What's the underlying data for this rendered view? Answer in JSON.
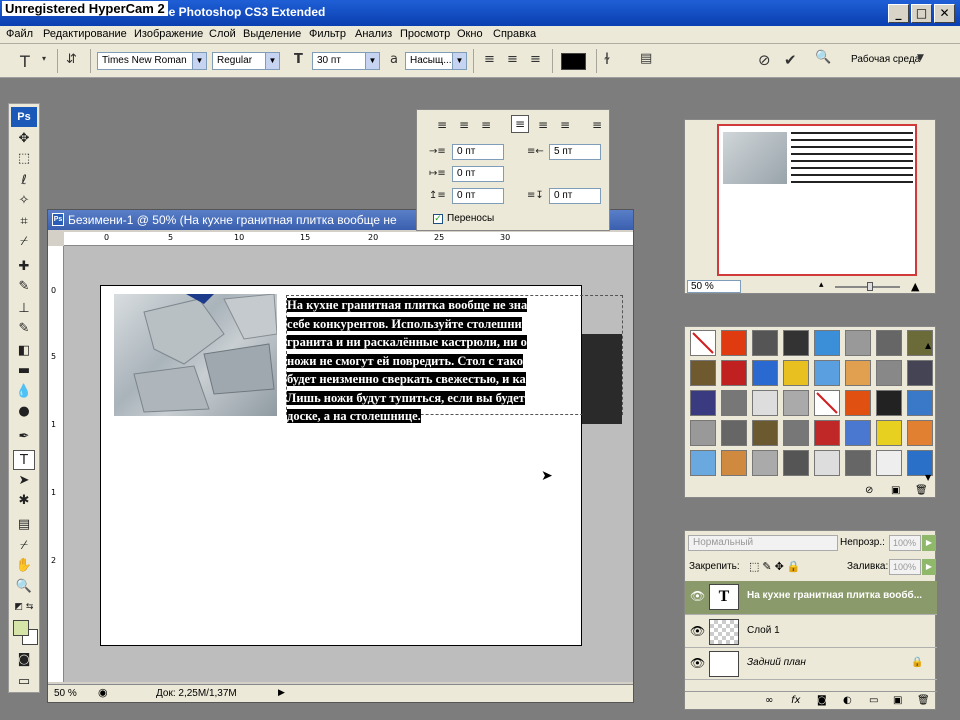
{
  "window": {
    "watermark": "Unregistered HyperCam 2",
    "title": "Adobe Photoshop CS3 Extended",
    "minimize": "_",
    "maximize": "□",
    "close": "✕"
  },
  "menu": [
    "Файл",
    "Редактирование",
    "Изображение",
    "Слой",
    "Выделение",
    "Фильтр",
    "Анализ",
    "Просмотр",
    "Окно",
    "Справка"
  ],
  "options": {
    "font_family": "Times New Roman",
    "font_style": "Regular",
    "font_size": "30 пт",
    "antialias_label": "a",
    "antialias": "Насыщ...",
    "color": "#000000",
    "workspace": "Рабочая среда"
  },
  "paragraph": {
    "left_indent": "0 пт",
    "right_indent": "5 пт",
    "first_line": "0 пт",
    "space_before": "0 пт",
    "space_after": "0 пт",
    "hyphenation": "Переносы"
  },
  "document": {
    "title": "Безимени-1 @ 50% (На кухне гранитная плитка вообще не",
    "text_lines": [
      "На кухне гранитная плитка вообще не зна",
      "себе конкурентов. Используйте столешни",
      "гранита и ни раскалённые кастрюли, ни о",
      "ножи не смогут ей повредить. Стол с тако",
      "будет неизменно сверкать свежестью, и ка",
      "Лишь ножи будут тупиться, если вы будет",
      "доске, а на столешнице."
    ],
    "ruler_top": [
      "0",
      "5",
      "10",
      "15",
      "20",
      "25",
      "30"
    ],
    "ruler_left": [
      "0",
      "5",
      "1",
      "1",
      "2"
    ],
    "zoom": "50 %",
    "doc_info": "Док: 2,25М/1,37М"
  },
  "navigator": {
    "zoom": "50 %"
  },
  "layers": {
    "blend_mode": "Нормальный",
    "opacity_label": "Непрозр.:",
    "opacity": "100%",
    "lock_label": "Закрепить:",
    "fill_label": "Заливка:",
    "fill": "100%",
    "items": [
      {
        "name": "На кухне гранитная плитка вообб...",
        "thumb": "T"
      },
      {
        "name": "Слой 1",
        "thumb": ""
      },
      {
        "name": "Задний план",
        "thumb": ""
      }
    ]
  }
}
